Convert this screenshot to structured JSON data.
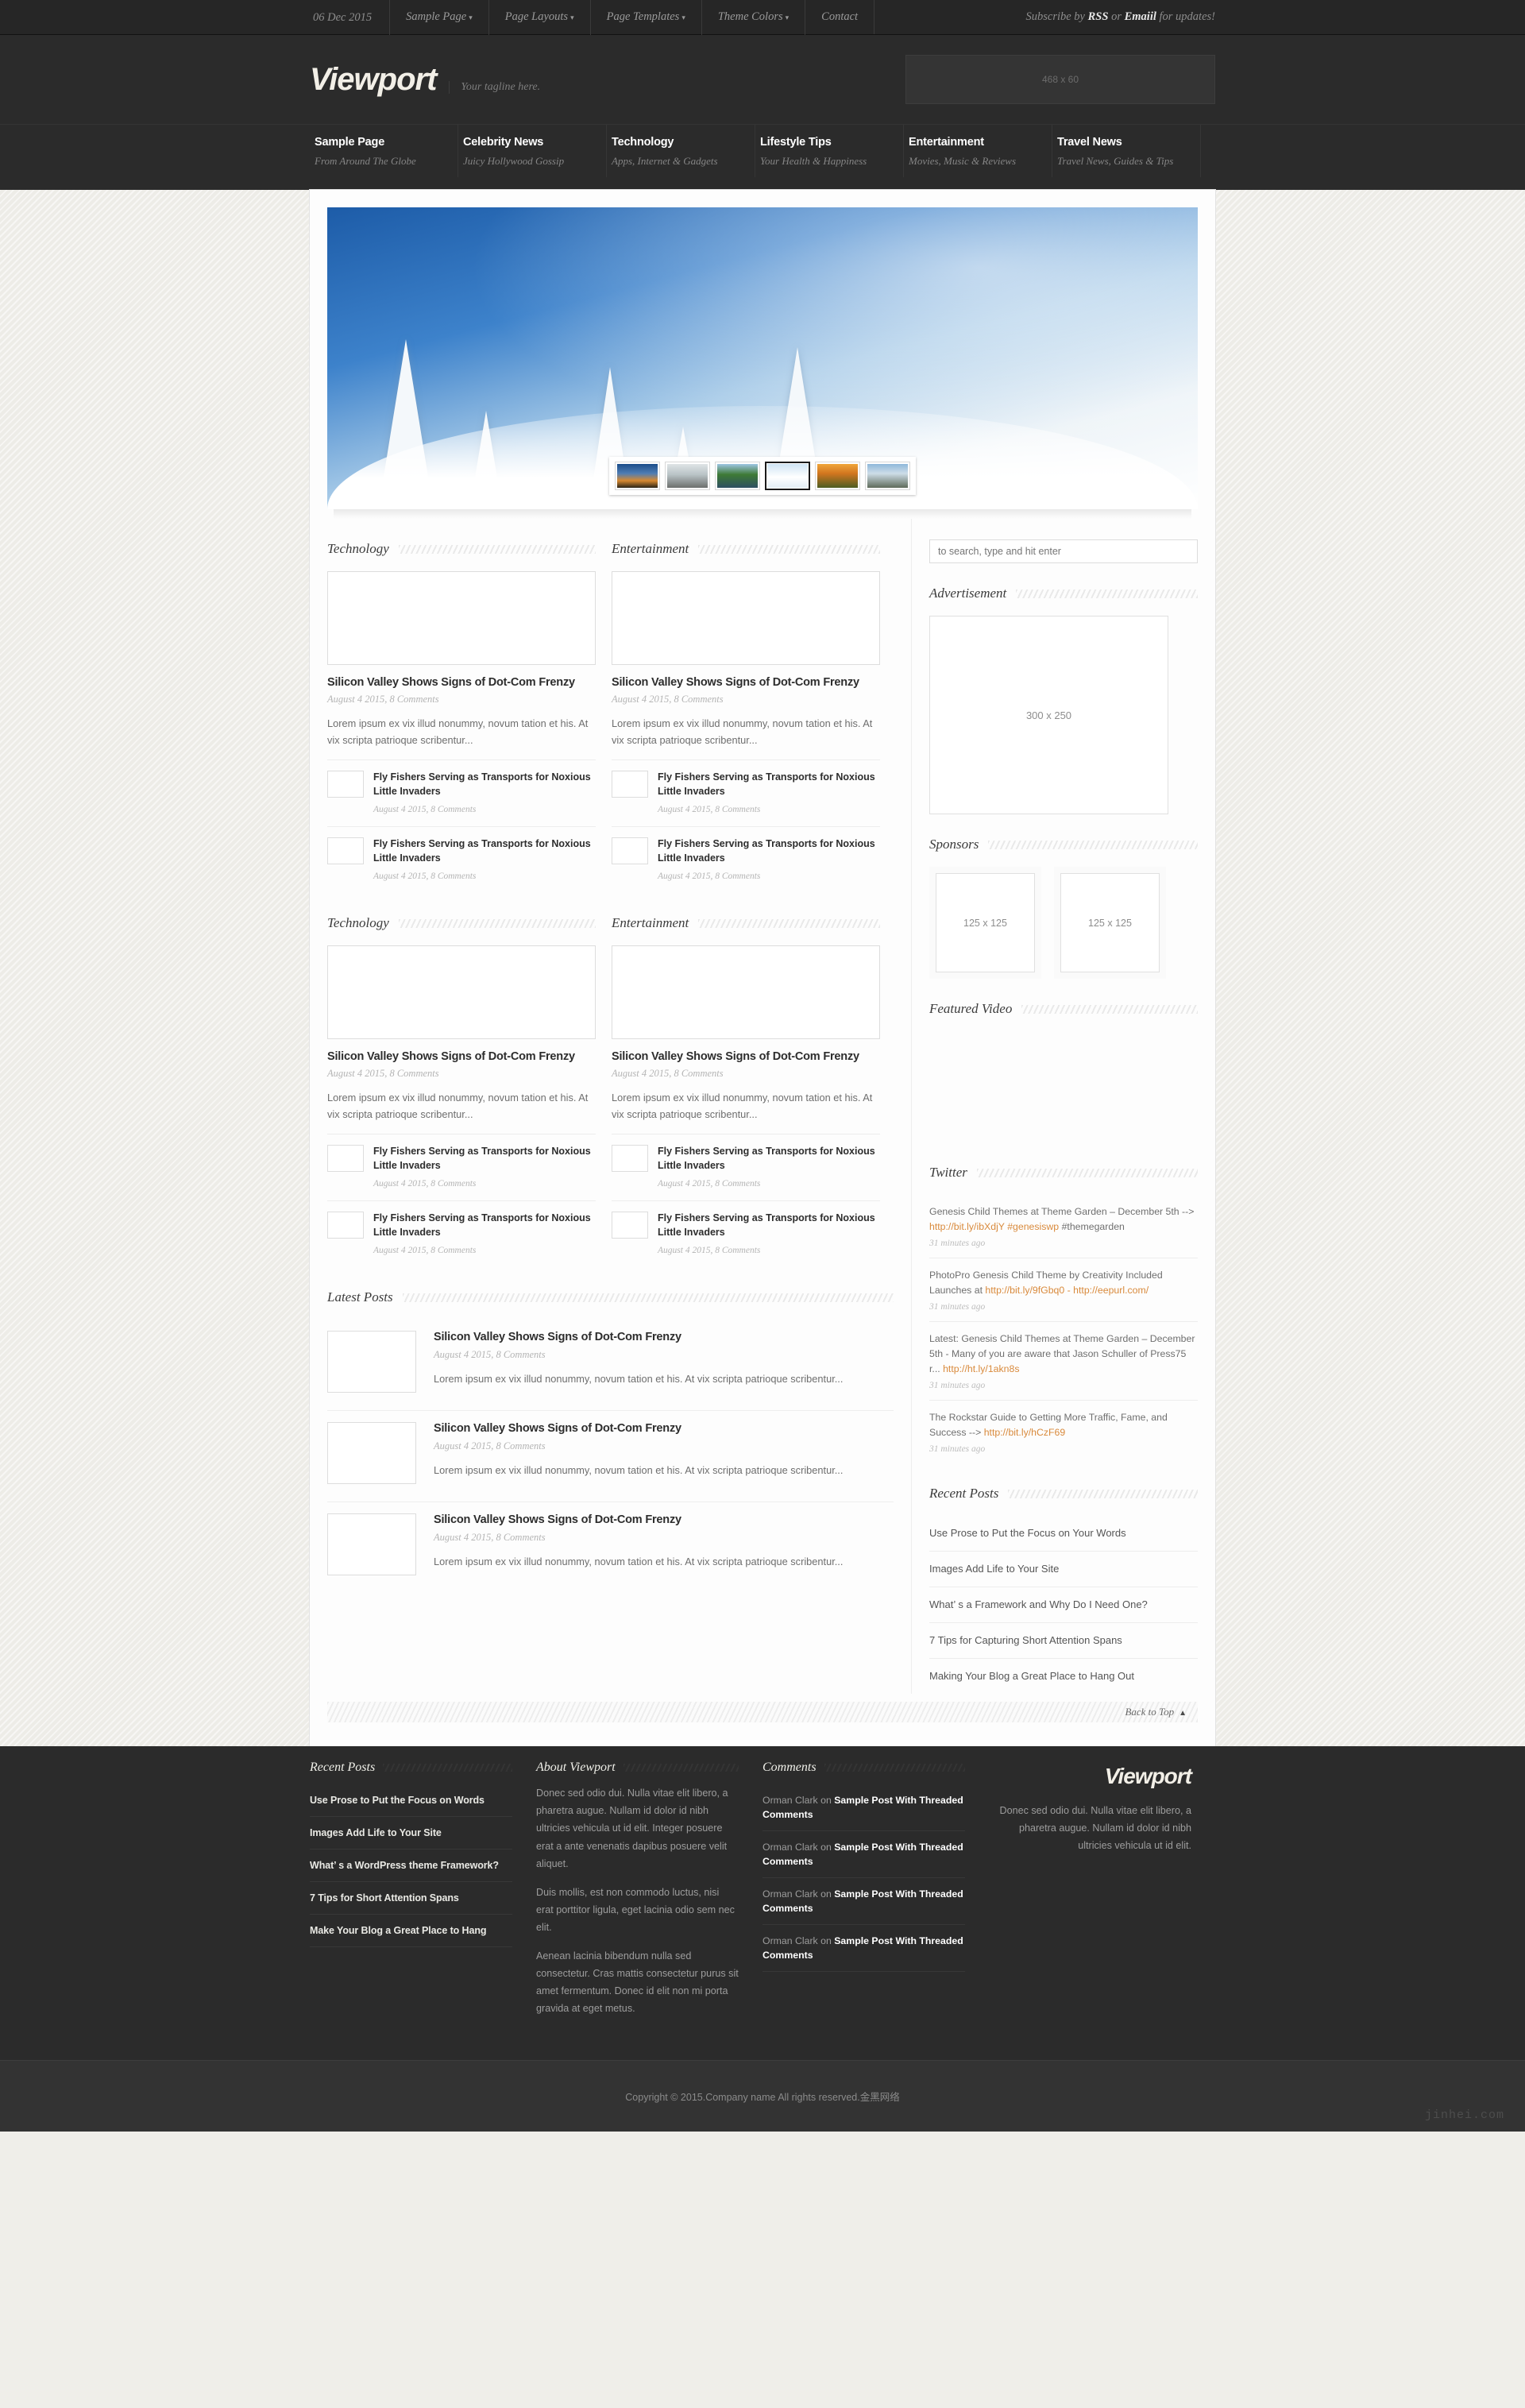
{
  "topbar": {
    "date": "06 Dec 2015",
    "menu": [
      {
        "label": "Sample Page",
        "caret": "▾"
      },
      {
        "label": "Page Layouts",
        "caret": "▾"
      },
      {
        "label": "Page Templates",
        "caret": "▾"
      },
      {
        "label": "Theme Colors",
        "caret": "▾"
      },
      {
        "label": "Contact",
        "caret": ""
      }
    ],
    "subscribe_pre": "Subscribe by ",
    "subscribe_rss": "RSS",
    "subscribe_mid": " or ",
    "subscribe_email": "Emaiil",
    "subscribe_post": " for updates!"
  },
  "header": {
    "logo": "Viewport",
    "tagline": "Your tagline here.",
    "ad_label": "468 x 60"
  },
  "mainnav": [
    {
      "title": "Sample Page",
      "sub": "From Around The Globe"
    },
    {
      "title": "Celebrity News",
      "sub": "Juicy Hollywood Gossip"
    },
    {
      "title": "Technology",
      "sub": "Apps, Internet & Gadgets"
    },
    {
      "title": "Lifestyle Tips",
      "sub": "Your Health & Happiness"
    },
    {
      "title": "Entertainment",
      "sub": "Movies, Music & Reviews"
    },
    {
      "title": "Travel News",
      "sub": "Travel News, Guides & Tips"
    }
  ],
  "slider": {
    "thumbs": [
      "thumb-sunset-tree",
      "thumb-pebble-beach",
      "thumb-lake-cabin",
      "thumb-snow-trees",
      "thumb-golden-field",
      "thumb-coastal-cliff"
    ],
    "active_index": 3
  },
  "blocks": [
    {
      "heading": "Technology",
      "image": "img-arch",
      "title": "Silicon Valley Shows Signs of Dot-Com Frenzy",
      "meta": "August 4 2015, 8 Comments",
      "excerpt": "Lorem ipsum ex vix illud nonummy, novum tation et his. At vix scripta patrioque scribentur...",
      "mini": [
        {
          "title": "Fly Fishers Serving as Transports for Noxious Little Invaders",
          "meta": "August 4 2015, 8 Comments",
          "image": "img-sm1"
        },
        {
          "title": "Fly Fishers Serving as Transports for Noxious Little Invaders",
          "meta": "August 4 2015, 8 Comments",
          "image": "img-sm3"
        }
      ]
    },
    {
      "heading": "Entertainment",
      "image": "img-store",
      "title": "Silicon Valley Shows Signs of Dot-Com Frenzy",
      "meta": "August 4 2015, 8 Comments",
      "excerpt": "Lorem ipsum ex vix illud nonummy, novum tation et his. At vix scripta patrioque scribentur...",
      "mini": [
        {
          "title": "Fly Fishers Serving as Transports for Noxious Little Invaders",
          "meta": "August 4 2015, 8 Comments",
          "image": "img-sm4"
        },
        {
          "title": "Fly Fishers Serving as Transports for Noxious Little Invaders",
          "meta": "August 4 2015, 8 Comments",
          "image": "img-sm5"
        }
      ]
    },
    {
      "heading": "Technology",
      "image": "img-bridge",
      "title": "Silicon Valley Shows Signs of Dot-Com Frenzy",
      "meta": "August 4 2015, 8 Comments",
      "excerpt": "Lorem ipsum ex vix illud nonummy, novum tation et his. At vix scripta patrioque scribentur...",
      "mini": [
        {
          "title": "Fly Fishers Serving as Transports for Noxious Little Invaders",
          "meta": "August 4 2015, 8 Comments",
          "image": "img-sm5"
        },
        {
          "title": "Fly Fishers Serving as Transports for Noxious Little Invaders",
          "meta": "August 4 2015, 8 Comments",
          "image": "img-sm4"
        }
      ]
    },
    {
      "heading": "Entertainment",
      "image": "img-pier",
      "title": "Silicon Valley Shows Signs of Dot-Com Frenzy",
      "meta": "August 4 2015, 8 Comments",
      "excerpt": "Lorem ipsum ex vix illud nonummy, novum tation et his. At vix scripta patrioque scribentur...",
      "mini": [
        {
          "title": "Fly Fishers Serving as Transports for Noxious Little Invaders",
          "meta": "August 4 2015, 8 Comments",
          "image": "img-sm6"
        },
        {
          "title": "Fly Fishers Serving as Transports for Noxious Little Invaders",
          "meta": "August 4 2015, 8 Comments",
          "image": "img-sm5"
        }
      ]
    }
  ],
  "latest_posts": {
    "heading": "Latest Posts",
    "items": [
      {
        "image": "img-city",
        "title": "Silicon Valley Shows Signs of Dot-Com Frenzy",
        "meta": "August 4 2015, 8 Comments",
        "excerpt": "Lorem ipsum ex vix illud nonummy, novum tation et his. At vix scripta patrioque scribentur..."
      },
      {
        "image": "img-moai",
        "title": "Silicon Valley Shows Signs of Dot-Com Frenzy",
        "meta": "August 4 2015, 8 Comments",
        "excerpt": "Lorem ipsum ex vix illud nonummy, novum tation et his. At vix scripta patrioque scribentur..."
      },
      {
        "image": "img-eiffel",
        "title": "Silicon Valley Shows Signs of Dot-Com Frenzy",
        "meta": "August 4 2015, 8 Comments",
        "excerpt": "Lorem ipsum ex vix illud nonummy, novum tation et his. At vix scripta patrioque scribentur..."
      }
    ]
  },
  "sidebar": {
    "search_placeholder": "to search, type and hit enter",
    "advertisement_heading": "Advertisement",
    "ad_label": "300 x 250",
    "sponsors_heading": "Sponsors",
    "sponsor_labels": [
      "125 x 125",
      "125 x 125"
    ],
    "video_heading": "Featured Video",
    "twitter_heading": "Twitter",
    "tweets": [
      {
        "pre": "Genesis Child Themes at Theme Garden – December 5th --> ",
        "link": "http://bit.ly/ibXdjY #genesiswp",
        "post": " #themegarden",
        "ago": "31 minutes ago"
      },
      {
        "pre": "PhotoPro Genesis Child Theme by Creativity Included Launches at ",
        "link": "http://bit.ly/9fGbq0 - http://eepurl.com/",
        "post": "",
        "ago": "31 minutes ago"
      },
      {
        "pre": "Latest: Genesis Child Themes at Theme Garden – December 5th - Many of you are aware that Jason Schuller of Press75 r... ",
        "link": "http://ht.ly/1akn8s",
        "post": "",
        "ago": "31 minutes ago"
      },
      {
        "pre": "The Rockstar Guide to Getting More Traffic, Fame, and Success --> ",
        "link": "http://bit.ly/hCzF69",
        "post": "",
        "ago": "31 minutes ago"
      }
    ],
    "recent_heading": "Recent Posts",
    "recent_items": [
      "Use Prose to Put the Focus on Your Words",
      "Images Add Life to Your Site",
      "What’ s a Framework and Why Do I Need One?",
      "7 Tips for Capturing Short Attention Spans",
      "Making Your Blog a Great Place to Hang Out"
    ]
  },
  "back_to_top": {
    "label": "Back to Top",
    "arrow": "▲"
  },
  "footer": {
    "recent_heading": "Recent Posts",
    "recent_items": [
      "Use Prose to Put the Focus on Words",
      "Images Add Life to Your Site",
      "What’ s a WordPress theme Framework?",
      "7 Tips for Short Attention Spans",
      "Make Your Blog a Great Place to Hang"
    ],
    "about_heading": "About Viewport",
    "about_paragraphs": [
      "Donec sed odio dui. Nulla vitae elit libero, a pharetra augue. Nullam id dolor id nibh ultricies vehicula ut id elit. Integer posuere erat a ante venenatis dapibus posuere velit aliquet.",
      "Duis mollis, est non commodo luctus, nisi erat porttitor ligula, eget lacinia odio sem nec elit.",
      "Aenean lacinia bibendum nulla sed consectetur. Cras mattis consectetur purus sit amet fermentum. Donec id elit non mi porta gravida at eget metus."
    ],
    "comments_heading": "Comments",
    "comments": [
      {
        "who": "Orman Clark on ",
        "post": "Sample Post With Threaded Comments"
      },
      {
        "who": "Orman Clark on ",
        "post": "Sample Post With Threaded Comments"
      },
      {
        "who": "Orman Clark on ",
        "post": "Sample Post With Threaded Comments"
      },
      {
        "who": "Orman Clark on ",
        "post": "Sample Post With Threaded Comments"
      }
    ],
    "brand_logo": "Viewport",
    "brand_text": "Donec sed odio dui. Nulla vitae elit libero, a pharetra augue. Nullam id dolor id nibh ultricies vehicula ut id elit."
  },
  "copyright": {
    "text": "Copyright © 2015.Company name All rights reserved.金黑网络",
    "watermark": "jinhei.com"
  }
}
